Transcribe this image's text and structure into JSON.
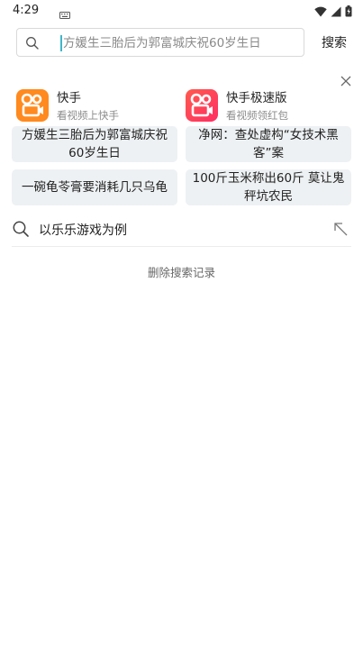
{
  "status_bar": {
    "time": "4:29"
  },
  "search": {
    "placeholder": "方媛生三胎后为郭富城庆祝60岁生日",
    "button_label": "搜索"
  },
  "apps": [
    {
      "name": "快手",
      "subtitle": "看视频上快手",
      "color": "#ff8a1f",
      "icon": "kuaishou-icon"
    },
    {
      "name": "快手极速版",
      "subtitle": "看视频领红包",
      "color": "#ff3b5c",
      "icon": "kuaishou-lite-icon"
    }
  ],
  "hot_searches": [
    "方媛生三胎后为郭富城庆祝60岁生日",
    "净网：查处虚构“女技术黑客”案",
    "一碗龟苓膏要消耗几只乌龟",
    "100斤玉米称出60斤 莫让鬼秤坑农民"
  ],
  "history": [
    {
      "text": "以乐乐游戏为例"
    }
  ],
  "clear_history_label": "删除搜索记录"
}
